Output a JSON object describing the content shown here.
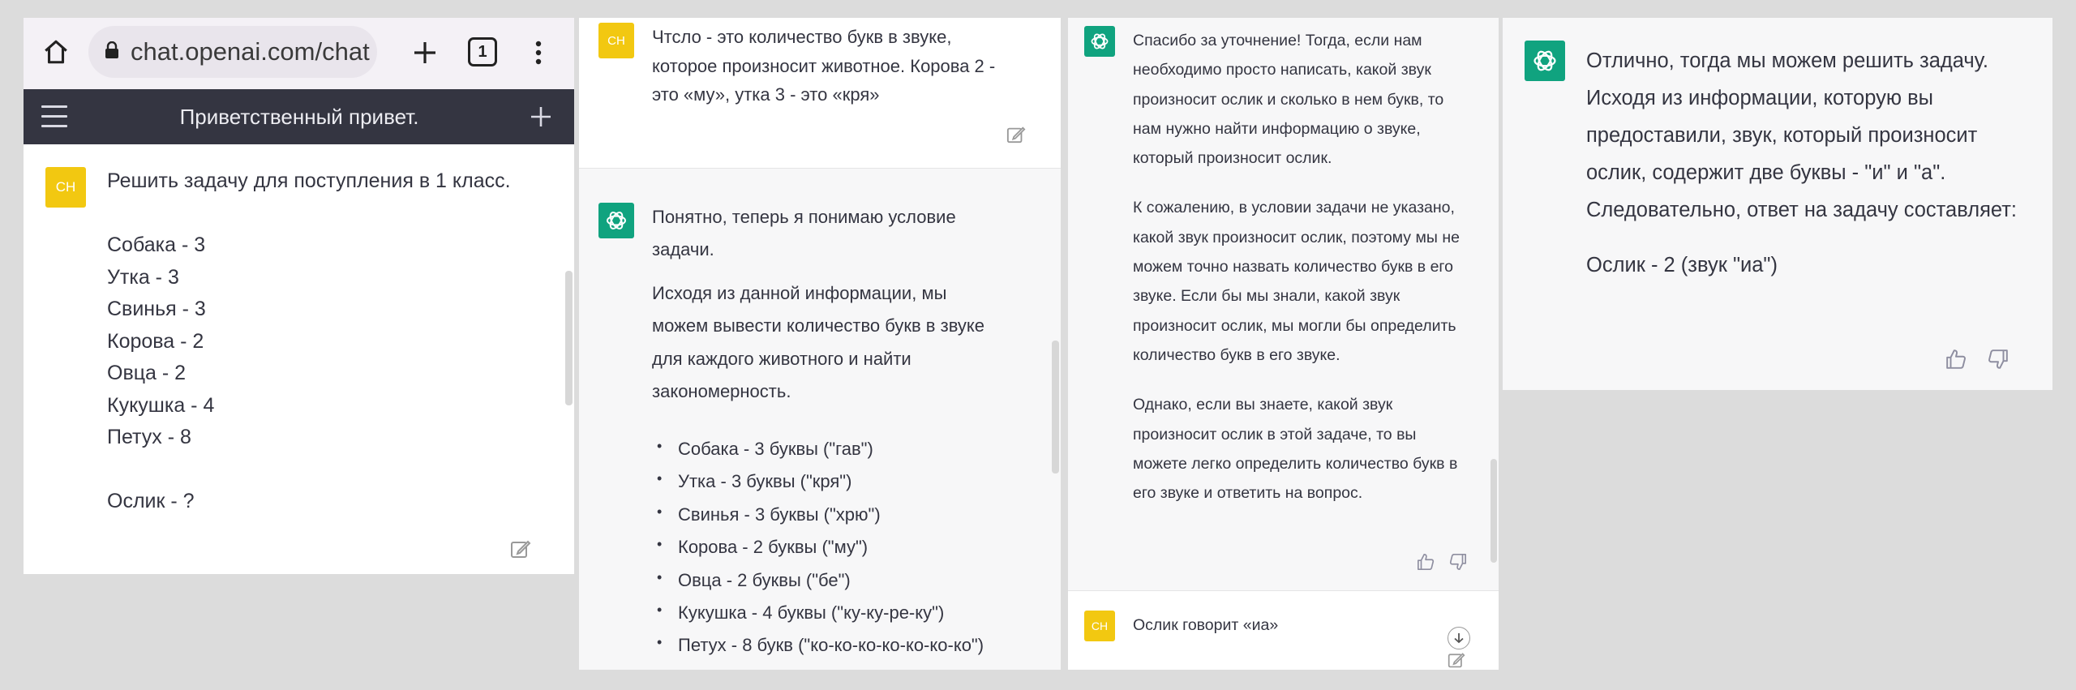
{
  "panel1": {
    "browser": {
      "url": "chat.openai.com/chat",
      "tab_count": "1"
    },
    "chat_header": {
      "title": "Приветственный привет."
    },
    "user_message": {
      "avatar": "CH",
      "text": "Решить задачу для поступления в 1 класс.\n\nСобака - 3\nУтка - 3\nСвинья - 3\nКорова - 2\nОвца - 2\nКукушка - 4\nПетух - 8\n\nОслик - ?"
    }
  },
  "panel2": {
    "user_message": {
      "avatar": "CH",
      "lines": [
        "Чтсло - это количество букв в звуке,",
        "которое произносит животное. Корова 2 -",
        "это «му», утка 3 - это «кря»"
      ]
    },
    "assistant_message": {
      "intro_lines": [
        "Понятно, теперь я понимаю условие",
        "задачи."
      ],
      "para_lines": [
        "Исходя из данной информации, мы",
        "можем вывести количество букв в звуке",
        "для каждого животного и найти",
        "закономерность."
      ],
      "bullets": [
        "Собака - 3 буквы (\"гав\")",
        "Утка - 3 буквы (\"кря\")",
        "Свинья - 3 буквы (\"хрю\")",
        "Корова - 2 буквы (\"му\")",
        "Овца - 2 буквы (\"бе\")",
        "Кукушка - 4 буквы (\"ку-ку-ре-ку\")",
        "Петух - 8 букв (\"ко-ко-ко-ко-ко-ко-ко\")"
      ]
    }
  },
  "panel3": {
    "assistant_message": {
      "paragraphs": [
        "Спасибо за уточнение! Тогда, если нам необходимо просто написать, какой звук произносит ослик и сколько в нем букв, то нам нужно найти информацию о звуке, который произносит ослик.",
        "К сожалению, в условии задачи не указано, какой звук произносит ослик, поэтому мы не можем точно назвать количество букв в его звуке. Если бы мы знали, какой звук произносит ослик, мы могли бы определить количество букв в его звуке.",
        "Однако, если вы знаете, какой звук произносит ослик в этой задаче, то вы можете легко определить количество букв в его звуке и ответить на вопрос."
      ]
    },
    "user_message": {
      "avatar": "CH",
      "text": "Ослик говорит «иа»"
    }
  },
  "panel4": {
    "assistant_message": {
      "paragraph1": "Отлично, тогда мы можем решить задачу. Исходя из информации, которую вы предоставили, звук, который произносит ослик, содержит две буквы - \"и\" и \"а\". Следовательно, ответ на задачу составляет:",
      "paragraph2": "Ослик - 2 (звук \"иа\")"
    }
  },
  "colors": {
    "header_dark": "#343541",
    "gpt_green": "#10a37f",
    "user_avatar": "#f2c811",
    "assistant_bg": "#f7f7f8"
  },
  "icons": [
    "home-icon",
    "lock-icon",
    "plus-icon",
    "tabs-icon",
    "more-vert-icon",
    "menu-icon",
    "edit-icon",
    "openai-logo-icon",
    "thumbs-up-icon",
    "thumbs-down-icon",
    "arrow-down-icon"
  ]
}
